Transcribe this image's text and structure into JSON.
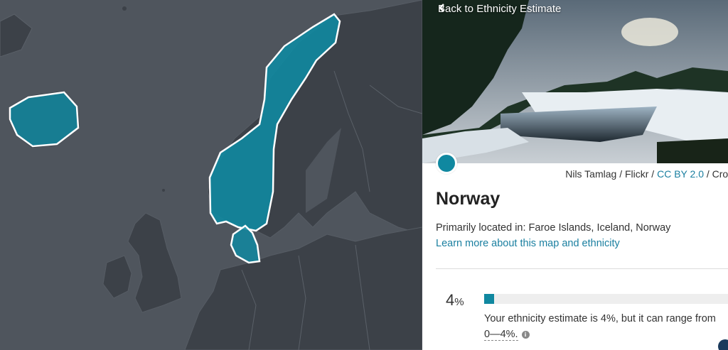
{
  "map": {
    "regions": [
      "Iceland",
      "Norway",
      "Denmark"
    ],
    "colors": {
      "region_fill": "#1088a0",
      "region_outline": "#ffffff",
      "land": "#3c4148",
      "sea": "#4f555d"
    }
  },
  "panel": {
    "back_link": "Back to Ethnicity Estimate",
    "photo_credit": {
      "author": "Nils Tamlag / Flickr /",
      "license": "CC BY 2.0",
      "suffix": "/ Crop"
    },
    "region_title": "Norway",
    "located_text": "Primarily located in: Faroe Islands, Iceland, Norway",
    "learn_more": "Learn more about this map and ethnicity",
    "estimate": {
      "percent": "4",
      "percent_sign": "%",
      "percent_value": 4,
      "description": "Your ethnicity estimate is 4%, but it can range from",
      "range": "0—4%."
    },
    "accent_color": "#1088a0"
  }
}
